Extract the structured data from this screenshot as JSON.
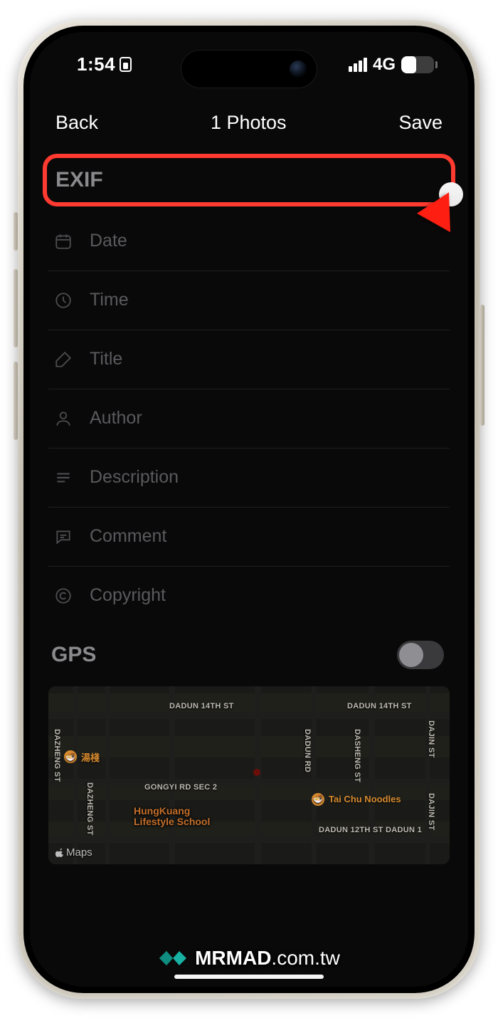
{
  "status": {
    "time": "1:54",
    "network_type": "4G",
    "battery_percent": "45"
  },
  "nav": {
    "back": "Back",
    "title": "1 Photos",
    "save": "Save"
  },
  "sections": {
    "exif": {
      "label": "EXIF",
      "toggle_on": false
    },
    "gps": {
      "label": "GPS",
      "toggle_on": false
    }
  },
  "rows": [
    {
      "icon": "calendar",
      "label": "Date"
    },
    {
      "icon": "clock",
      "label": "Time"
    },
    {
      "icon": "pencil-note",
      "label": "Title"
    },
    {
      "icon": "person",
      "label": "Author"
    },
    {
      "icon": "lines",
      "label": "Description"
    },
    {
      "icon": "comment",
      "label": "Comment"
    },
    {
      "icon": "copyright",
      "label": "Copyright"
    }
  ],
  "map": {
    "provider": "Maps",
    "streets": {
      "dadun14a": "DADUN 14TH ST",
      "dadun14b": "DADUN 14TH ST",
      "dadun12": "DADUN 12TH ST DADUN 1",
      "dazheng": "DAZHENG ST",
      "dazheng2": "DAZHENG ST",
      "dasheng": "DASHENG ST",
      "dajin": "DAJIN ST",
      "dajin2": "DAJIN ST",
      "dadun_rd": "DADUN RD",
      "gongyi": "GONGYI RD SEC 2"
    },
    "pois": {
      "tanglao": "湯棧",
      "taichu": "Tai Chu Noodles",
      "school1": "HungKuang",
      "school2": "Lifestyle School"
    }
  },
  "watermark": {
    "brand": "MRMAD",
    "domain": ".com.tw"
  },
  "highlight_accent": "#ff3a30"
}
